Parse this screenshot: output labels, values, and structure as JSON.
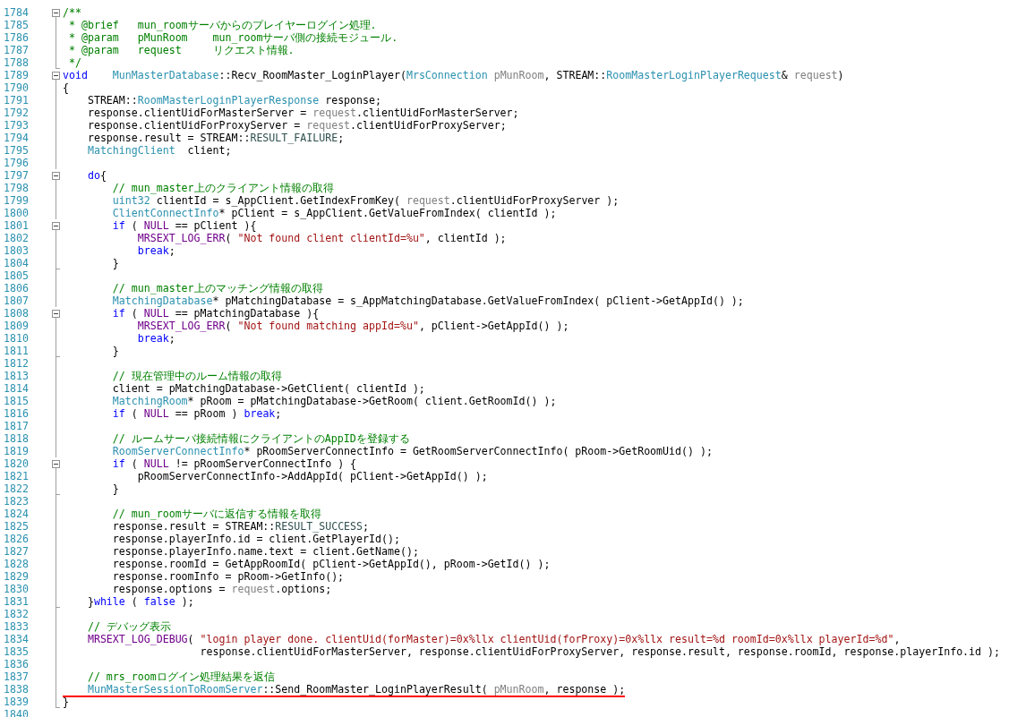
{
  "lines": [
    {
      "number": "1784",
      "fold_toggle": true,
      "block_end": false,
      "underlined": false,
      "tokens": [
        {
          "kind": "comment",
          "text": "/**"
        }
      ]
    },
    {
      "number": "1785",
      "fold_toggle": false,
      "block_end": false,
      "underlined": false,
      "tokens": [
        {
          "kind": "comment",
          "text": " * @brief   mun_roomサーバからのプレイヤーログイン処理."
        }
      ]
    },
    {
      "number": "1786",
      "fold_toggle": false,
      "block_end": false,
      "underlined": false,
      "tokens": [
        {
          "kind": "comment",
          "text": " * @param   pMunRoom    mun_roomサーバ側の接続モジュール."
        }
      ]
    },
    {
      "number": "1787",
      "fold_toggle": false,
      "block_end": false,
      "underlined": false,
      "tokens": [
        {
          "kind": "comment",
          "text": " * @param   request     リクエスト情報."
        }
      ]
    },
    {
      "number": "1788",
      "fold_toggle": false,
      "block_end": true,
      "underlined": false,
      "tokens": [
        {
          "kind": "comment",
          "text": " */"
        }
      ]
    },
    {
      "number": "1789",
      "fold_toggle": true,
      "block_end": false,
      "underlined": false,
      "tokens": [
        {
          "kind": "keyword",
          "text": "void"
        },
        {
          "kind": "type",
          "text": "    MunMasterDatabase"
        },
        {
          "kind": "plain",
          "text": "::Recv_RoomMaster_LoginPlayer("
        },
        {
          "kind": "type",
          "text": "MrsConnection"
        },
        {
          "kind": "param",
          "text": " pMunRoom"
        },
        {
          "kind": "plain",
          "text": ", STREAM::"
        },
        {
          "kind": "type",
          "text": "RoomMasterLoginPlayerRequest"
        },
        {
          "kind": "plain",
          "text": "& "
        },
        {
          "kind": "param",
          "text": "request"
        },
        {
          "kind": "plain",
          "text": ")"
        }
      ]
    },
    {
      "number": "1790",
      "fold_toggle": false,
      "block_end": false,
      "underlined": false,
      "tokens": [
        {
          "kind": "plain",
          "text": "{"
        }
      ]
    },
    {
      "number": "1791",
      "fold_toggle": false,
      "block_end": false,
      "underlined": false,
      "tokens": [
        {
          "kind": "plain",
          "text": "    STREAM::"
        },
        {
          "kind": "type",
          "text": "RoomMasterLoginPlayerResponse"
        },
        {
          "kind": "plain",
          "text": " response;"
        }
      ]
    },
    {
      "number": "1792",
      "fold_toggle": false,
      "block_end": false,
      "underlined": false,
      "tokens": [
        {
          "kind": "plain",
          "text": "    response.clientUidForMasterServer = "
        },
        {
          "kind": "param",
          "text": "request"
        },
        {
          "kind": "plain",
          "text": ".clientUidForMasterServer;"
        }
      ]
    },
    {
      "number": "1793",
      "fold_toggle": false,
      "block_end": false,
      "underlined": false,
      "tokens": [
        {
          "kind": "plain",
          "text": "    response.clientUidForProxyServer = "
        },
        {
          "kind": "param",
          "text": "request"
        },
        {
          "kind": "plain",
          "text": ".clientUidForProxyServer;"
        }
      ]
    },
    {
      "number": "1794",
      "fold_toggle": false,
      "block_end": false,
      "underlined": false,
      "tokens": [
        {
          "kind": "plain",
          "text": "    response.result = STREAM::"
        },
        {
          "kind": "enum",
          "text": "RESULT_FAILURE"
        },
        {
          "kind": "plain",
          "text": ";"
        }
      ]
    },
    {
      "number": "1795",
      "fold_toggle": false,
      "block_end": false,
      "underlined": false,
      "tokens": [
        {
          "kind": "type",
          "text": "    MatchingClient"
        },
        {
          "kind": "plain",
          "text": "  client;"
        }
      ]
    },
    {
      "number": "1796",
      "fold_toggle": false,
      "block_end": false,
      "underlined": false
    },
    {
      "number": "1797",
      "fold_toggle": true,
      "block_end": false,
      "underlined": false,
      "tokens": [
        {
          "kind": "keyword",
          "text": "    do"
        },
        {
          "kind": "plain",
          "text": "{"
        }
      ]
    },
    {
      "number": "1798",
      "fold_toggle": false,
      "block_end": false,
      "underlined": false,
      "tokens": [
        {
          "kind": "comment",
          "text": "        // mun_master上のクライアント情報の取得"
        }
      ]
    },
    {
      "number": "1799",
      "fold_toggle": false,
      "block_end": false,
      "underlined": false,
      "tokens": [
        {
          "kind": "type",
          "text": "        uint32"
        },
        {
          "kind": "plain",
          "text": " clientId = s_AppClient.GetIndexFromKey( "
        },
        {
          "kind": "param",
          "text": "request"
        },
        {
          "kind": "plain",
          "text": ".clientUidForProxyServer );"
        }
      ]
    },
    {
      "number": "1800",
      "fold_toggle": false,
      "block_end": false,
      "underlined": false,
      "tokens": [
        {
          "kind": "type",
          "text": "        ClientConnectInfo"
        },
        {
          "kind": "plain",
          "text": "* pClient = s_AppClient.GetValueFromIndex( clientId );"
        }
      ]
    },
    {
      "number": "1801",
      "fold_toggle": true,
      "block_end": false,
      "underlined": false,
      "tokens": [
        {
          "kind": "keyword",
          "text": "        if"
        },
        {
          "kind": "plain",
          "text": " ( "
        },
        {
          "kind": "macro",
          "text": "NULL"
        },
        {
          "kind": "plain",
          "text": " == pClient ){"
        }
      ]
    },
    {
      "number": "1802",
      "fold_toggle": false,
      "block_end": false,
      "underlined": false,
      "tokens": [
        {
          "kind": "macro",
          "text": "            MRSEXT_LOG_ERR"
        },
        {
          "kind": "plain",
          "text": "( "
        },
        {
          "kind": "string",
          "text": "\"Not found client clientId=%u\""
        },
        {
          "kind": "plain",
          "text": ", clientId );"
        }
      ]
    },
    {
      "number": "1803",
      "fold_toggle": false,
      "block_end": false,
      "underlined": false,
      "tokens": [
        {
          "kind": "keyword",
          "text": "            break"
        },
        {
          "kind": "plain",
          "text": ";"
        }
      ]
    },
    {
      "number": "1804",
      "fold_toggle": false,
      "block_end": true,
      "underlined": false,
      "tokens": [
        {
          "kind": "plain",
          "text": "        }"
        }
      ]
    },
    {
      "number": "1805",
      "fold_toggle": false,
      "block_end": false,
      "underlined": false
    },
    {
      "number": "1806",
      "fold_toggle": false,
      "block_end": false,
      "underlined": false,
      "tokens": [
        {
          "kind": "comment",
          "text": "        // mun_master上のマッチング情報の取得"
        }
      ]
    },
    {
      "number": "1807",
      "fold_toggle": false,
      "block_end": false,
      "underlined": false,
      "tokens": [
        {
          "kind": "type",
          "text": "        MatchingDatabase"
        },
        {
          "kind": "plain",
          "text": "* pMatchingDatabase = s_AppMatchingDatabase.GetValueFromIndex( pClient->GetAppId() );"
        }
      ]
    },
    {
      "number": "1808",
      "fold_toggle": true,
      "block_end": false,
      "underlined": false,
      "tokens": [
        {
          "kind": "keyword",
          "text": "        if"
        },
        {
          "kind": "plain",
          "text": " ( "
        },
        {
          "kind": "macro",
          "text": "NULL"
        },
        {
          "kind": "plain",
          "text": " == pMatchingDatabase ){"
        }
      ]
    },
    {
      "number": "1809",
      "fold_toggle": false,
      "block_end": false,
      "underlined": false,
      "tokens": [
        {
          "kind": "macro",
          "text": "            MRSEXT_LOG_ERR"
        },
        {
          "kind": "plain",
          "text": "( "
        },
        {
          "kind": "string",
          "text": "\"Not found matching appId=%u\""
        },
        {
          "kind": "plain",
          "text": ", pClient->GetAppId() );"
        }
      ]
    },
    {
      "number": "1810",
      "fold_toggle": false,
      "block_end": false,
      "underlined": false,
      "tokens": [
        {
          "kind": "keyword",
          "text": "            break"
        },
        {
          "kind": "plain",
          "text": ";"
        }
      ]
    },
    {
      "number": "1811",
      "fold_toggle": false,
      "block_end": true,
      "underlined": false,
      "tokens": [
        {
          "kind": "plain",
          "text": "        }"
        }
      ]
    },
    {
      "number": "1812",
      "fold_toggle": false,
      "block_end": false,
      "underlined": false
    },
    {
      "number": "1813",
      "fold_toggle": false,
      "block_end": false,
      "underlined": false,
      "tokens": [
        {
          "kind": "comment",
          "text": "        // 現在管理中のルーム情報の取得"
        }
      ]
    },
    {
      "number": "1814",
      "fold_toggle": false,
      "block_end": false,
      "underlined": false,
      "tokens": [
        {
          "kind": "plain",
          "text": "        client = pMatchingDatabase->GetClient( clientId );"
        }
      ]
    },
    {
      "number": "1815",
      "fold_toggle": false,
      "block_end": false,
      "underlined": false,
      "tokens": [
        {
          "kind": "type",
          "text": "        MatchingRoom"
        },
        {
          "kind": "plain",
          "text": "* pRoom = pMatchingDatabase->GetRoom( client.GetRoomId() );"
        }
      ]
    },
    {
      "number": "1816",
      "fold_toggle": false,
      "block_end": false,
      "underlined": false,
      "tokens": [
        {
          "kind": "keyword",
          "text": "        if"
        },
        {
          "kind": "plain",
          "text": " ( "
        },
        {
          "kind": "macro",
          "text": "NULL"
        },
        {
          "kind": "plain",
          "text": " == pRoom ) "
        },
        {
          "kind": "keyword",
          "text": "break"
        },
        {
          "kind": "plain",
          "text": ";"
        }
      ]
    },
    {
      "number": "1817",
      "fold_toggle": false,
      "block_end": false,
      "underlined": false
    },
    {
      "number": "1818",
      "fold_toggle": false,
      "block_end": false,
      "underlined": false,
      "tokens": [
        {
          "kind": "comment",
          "text": "        // ルームサーバ接続情報にクライアントのAppIDを登録する"
        }
      ]
    },
    {
      "number": "1819",
      "fold_toggle": false,
      "block_end": false,
      "underlined": false,
      "tokens": [
        {
          "kind": "type",
          "text": "        RoomServerConnectInfo"
        },
        {
          "kind": "plain",
          "text": "* pRoomServerConnectInfo = GetRoomServerConnectInfo( pRoom->GetRoomUid() );"
        }
      ]
    },
    {
      "number": "1820",
      "fold_toggle": true,
      "block_end": false,
      "underlined": false,
      "tokens": [
        {
          "kind": "keyword",
          "text": "        if"
        },
        {
          "kind": "plain",
          "text": " ( "
        },
        {
          "kind": "macro",
          "text": "NULL"
        },
        {
          "kind": "plain",
          "text": " != pRoomServerConnectInfo ) {"
        }
      ]
    },
    {
      "number": "1821",
      "fold_toggle": false,
      "block_end": false,
      "underlined": false,
      "tokens": [
        {
          "kind": "plain",
          "text": "            pRoomServerConnectInfo->AddAppId( pClient->GetAppId() );"
        }
      ]
    },
    {
      "number": "1822",
      "fold_toggle": false,
      "block_end": true,
      "underlined": false,
      "tokens": [
        {
          "kind": "plain",
          "text": "        }"
        }
      ]
    },
    {
      "number": "1823",
      "fold_toggle": false,
      "block_end": false,
      "underlined": false
    },
    {
      "number": "1824",
      "fold_toggle": false,
      "block_end": false,
      "underlined": false,
      "tokens": [
        {
          "kind": "comment",
          "text": "        // mun_roomサーバに返信する情報を取得"
        }
      ]
    },
    {
      "number": "1825",
      "fold_toggle": false,
      "block_end": false,
      "underlined": false,
      "tokens": [
        {
          "kind": "plain",
          "text": "        response.result = STREAM::"
        },
        {
          "kind": "enum",
          "text": "RESULT_SUCCESS"
        },
        {
          "kind": "plain",
          "text": ";"
        }
      ]
    },
    {
      "number": "1826",
      "fold_toggle": false,
      "block_end": false,
      "underlined": false,
      "tokens": [
        {
          "kind": "plain",
          "text": "        response.playerInfo.id = client.GetPlayerId();"
        }
      ]
    },
    {
      "number": "1827",
      "fold_toggle": false,
      "block_end": false,
      "underlined": false,
      "tokens": [
        {
          "kind": "plain",
          "text": "        response.playerInfo.name.text = client.GetName();"
        }
      ]
    },
    {
      "number": "1828",
      "fold_toggle": false,
      "block_end": false,
      "underlined": false,
      "tokens": [
        {
          "kind": "plain",
          "text": "        response.roomId = GetAppRoomId( pClient->GetAppId(), pRoom->GetId() );"
        }
      ]
    },
    {
      "number": "1829",
      "fold_toggle": false,
      "block_end": false,
      "underlined": false,
      "tokens": [
        {
          "kind": "plain",
          "text": "        response.roomInfo = pRoom->GetInfo();"
        }
      ]
    },
    {
      "number": "1830",
      "fold_toggle": false,
      "block_end": false,
      "underlined": false,
      "tokens": [
        {
          "kind": "plain",
          "text": "        response.options = "
        },
        {
          "kind": "param",
          "text": "request"
        },
        {
          "kind": "plain",
          "text": ".options;"
        }
      ]
    },
    {
      "number": "1831",
      "fold_toggle": false,
      "block_end": true,
      "underlined": false,
      "tokens": [
        {
          "kind": "plain",
          "text": "    }"
        },
        {
          "kind": "keyword",
          "text": "while"
        },
        {
          "kind": "plain",
          "text": " ( "
        },
        {
          "kind": "keyword",
          "text": "false"
        },
        {
          "kind": "plain",
          "text": " );"
        }
      ]
    },
    {
      "number": "1832",
      "fold_toggle": false,
      "block_end": false,
      "underlined": false
    },
    {
      "number": "1833",
      "fold_toggle": false,
      "block_end": false,
      "underlined": false,
      "tokens": [
        {
          "kind": "comment",
          "text": "    // デバッグ表示"
        }
      ]
    },
    {
      "number": "1834",
      "fold_toggle": false,
      "block_end": false,
      "underlined": false,
      "tokens": [
        {
          "kind": "macro",
          "text": "    MRSEXT_LOG_DEBUG"
        },
        {
          "kind": "plain",
          "text": "( "
        },
        {
          "kind": "string",
          "text": "\"login player done. clientUid(forMaster)=0x%llx clientUid(forProxy)=0x%llx result=%d roomId=0x%llx playerId=%d\""
        },
        {
          "kind": "plain",
          "text": ","
        }
      ]
    },
    {
      "number": "1835",
      "fold_toggle": false,
      "block_end": false,
      "underlined": false,
      "tokens": [
        {
          "kind": "plain",
          "text": "                      response.clientUidForMasterServer, response.clientUidForProxyServer, response.result, response.roomId, response.playerInfo.id );"
        }
      ]
    },
    {
      "number": "1836",
      "fold_toggle": false,
      "block_end": false,
      "underlined": false
    },
    {
      "number": "1837",
      "fold_toggle": false,
      "block_end": false,
      "underlined": false,
      "tokens": [
        {
          "kind": "comment",
          "text": "    // mrs_roomログイン処理結果を返信"
        }
      ]
    },
    {
      "number": "1838",
      "fold_toggle": false,
      "block_end": false,
      "underlined": true,
      "tokens": [
        {
          "kind": "type",
          "text": "    MunMasterSessionToRoomServer"
        },
        {
          "kind": "plain",
          "text": "::Send_RoomMaster_LoginPlayerResult( "
        },
        {
          "kind": "param",
          "text": "pMunRoom"
        },
        {
          "kind": "plain",
          "text": ", response );"
        }
      ]
    },
    {
      "number": "1839",
      "fold_toggle": false,
      "block_end": true,
      "underlined": false,
      "tokens": [
        {
          "kind": "plain",
          "text": "}"
        }
      ]
    },
    {
      "number": "1840",
      "fold_toggle": false,
      "block_end": false,
      "underlined": false
    }
  ]
}
